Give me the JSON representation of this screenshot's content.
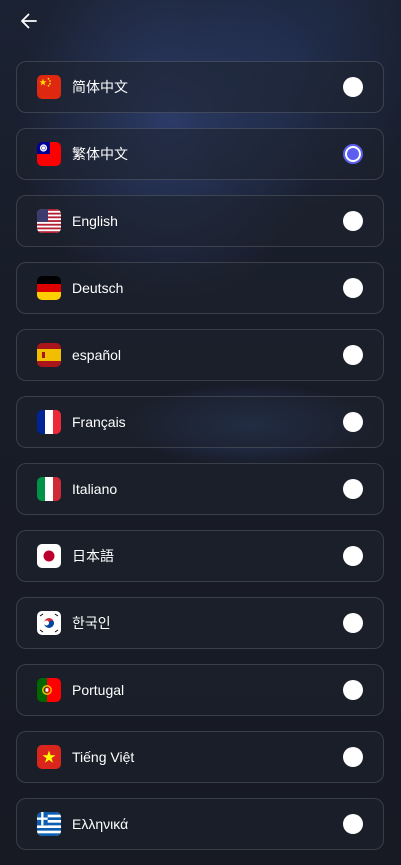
{
  "header": {
    "back_icon": "arrow-left-icon"
  },
  "colors": {
    "accent": "#5b5ef0",
    "card_border": "#3a3f4d",
    "text": "#ffffff"
  },
  "languages": [
    {
      "label": "简体中文",
      "flag": "china-flag-icon",
      "selected": false
    },
    {
      "label": "繁体中文",
      "flag": "taiwan-flag-icon",
      "selected": true
    },
    {
      "label": "English",
      "flag": "usa-flag-icon",
      "selected": false
    },
    {
      "label": "Deutsch",
      "flag": "germany-flag-icon",
      "selected": false
    },
    {
      "label": "español",
      "flag": "spain-flag-icon",
      "selected": false
    },
    {
      "label": "Français",
      "flag": "france-flag-icon",
      "selected": false
    },
    {
      "label": "Italiano",
      "flag": "italy-flag-icon",
      "selected": false
    },
    {
      "label": "日本語",
      "flag": "japan-flag-icon",
      "selected": false
    },
    {
      "label": "한국인",
      "flag": "korea-flag-icon",
      "selected": false
    },
    {
      "label": "Portugal",
      "flag": "portugal-flag-icon",
      "selected": false
    },
    {
      "label": "Tiếng Việt",
      "flag": "vietnam-flag-icon",
      "selected": false
    },
    {
      "label": "Ελληνικά",
      "flag": "greece-flag-icon",
      "selected": false
    }
  ]
}
